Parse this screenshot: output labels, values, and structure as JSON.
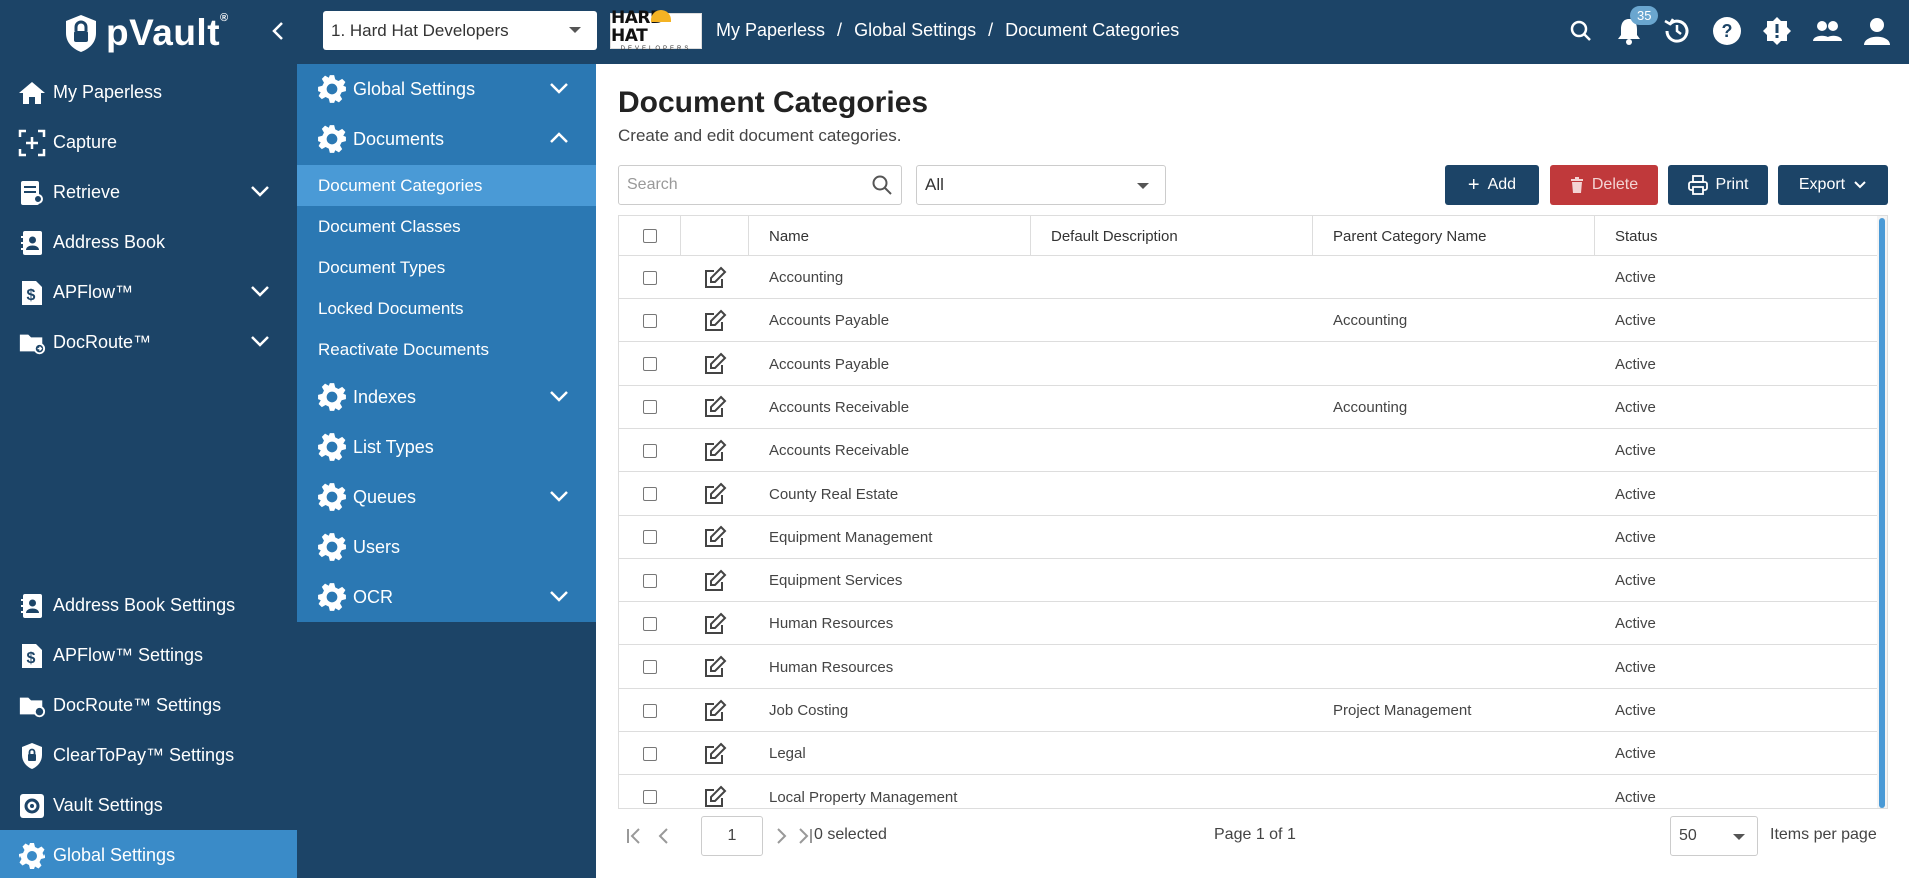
{
  "app": {
    "name": "pVault",
    "trademark": "®"
  },
  "header": {
    "company_select": "1. Hard Hat Developers",
    "company_logo_text": "HARD HAT",
    "company_logo_sub": "DEVELOPERS",
    "breadcrumb": [
      "My Paperless",
      "Global Settings",
      "Document Categories"
    ],
    "notification_count": "35"
  },
  "sidebar": {
    "items": [
      {
        "label": "My Paperless",
        "icon": "home-icon"
      },
      {
        "label": "Capture",
        "icon": "capture-icon"
      },
      {
        "label": "Retrieve",
        "icon": "retrieve-icon"
      },
      {
        "label": "Address Book",
        "icon": "address-book-icon"
      },
      {
        "label": "APFlow™",
        "icon": "dollar-doc-icon"
      },
      {
        "label": "DocRoute™",
        "icon": "folder-route-icon"
      }
    ],
    "settings": [
      {
        "label": "Address Book Settings"
      },
      {
        "label": "APFlow™ Settings"
      },
      {
        "label": "DocRoute™ Settings"
      },
      {
        "label": "ClearToPay™ Settings"
      },
      {
        "label": "Vault Settings"
      },
      {
        "label": "Global Settings"
      }
    ]
  },
  "subnav": {
    "global_settings": "Global Settings",
    "documents": "Documents",
    "doc_links": [
      "Document Categories",
      "Document Classes",
      "Document Types",
      "Locked Documents",
      "Reactivate Documents"
    ],
    "indexes": "Indexes",
    "list_types": "List Types",
    "queues": "Queues",
    "users": "Users",
    "ocr": "OCR"
  },
  "main": {
    "title": "Document Categories",
    "subtitle": "Create and edit document categories.",
    "search_placeholder": "Search",
    "filter_value": "All",
    "buttons": {
      "add": "Add",
      "delete": "Delete",
      "print": "Print",
      "export": "Export"
    }
  },
  "table": {
    "columns": [
      "Name",
      "Default Description",
      "Parent Category Name",
      "Status"
    ],
    "rows": [
      {
        "name": "Accounting",
        "description": "",
        "parent": "",
        "status": "Active"
      },
      {
        "name": "Accounts Payable",
        "description": "",
        "parent": "Accounting",
        "status": "Active"
      },
      {
        "name": "Accounts Payable",
        "description": "",
        "parent": "",
        "status": "Active"
      },
      {
        "name": "Accounts Receivable",
        "description": "",
        "parent": "Accounting",
        "status": "Active"
      },
      {
        "name": "Accounts Receivable",
        "description": "",
        "parent": "",
        "status": "Active"
      },
      {
        "name": "County Real Estate",
        "description": "",
        "parent": "",
        "status": "Active"
      },
      {
        "name": "Equipment Management",
        "description": "",
        "parent": "",
        "status": "Active"
      },
      {
        "name": "Equipment Services",
        "description": "",
        "parent": "",
        "status": "Active"
      },
      {
        "name": "Human Resources",
        "description": "",
        "parent": "",
        "status": "Active"
      },
      {
        "name": "Human Resources",
        "description": "",
        "parent": "",
        "status": "Active"
      },
      {
        "name": "Job Costing",
        "description": "",
        "parent": "Project Management",
        "status": "Active"
      },
      {
        "name": "Legal",
        "description": "",
        "parent": "",
        "status": "Active"
      },
      {
        "name": "Local Property Management",
        "description": "",
        "parent": "",
        "status": "Active"
      }
    ]
  },
  "pager": {
    "page": "1",
    "selected": "0 selected",
    "info": "Page 1 of 1",
    "page_size": "50",
    "items_label": "Items per page"
  },
  "colors": {
    "nav_dark": "#1c4467",
    "nav_mid": "#2b78b3",
    "nav_active": "#4a9ad6",
    "danger": "#c0393b"
  }
}
